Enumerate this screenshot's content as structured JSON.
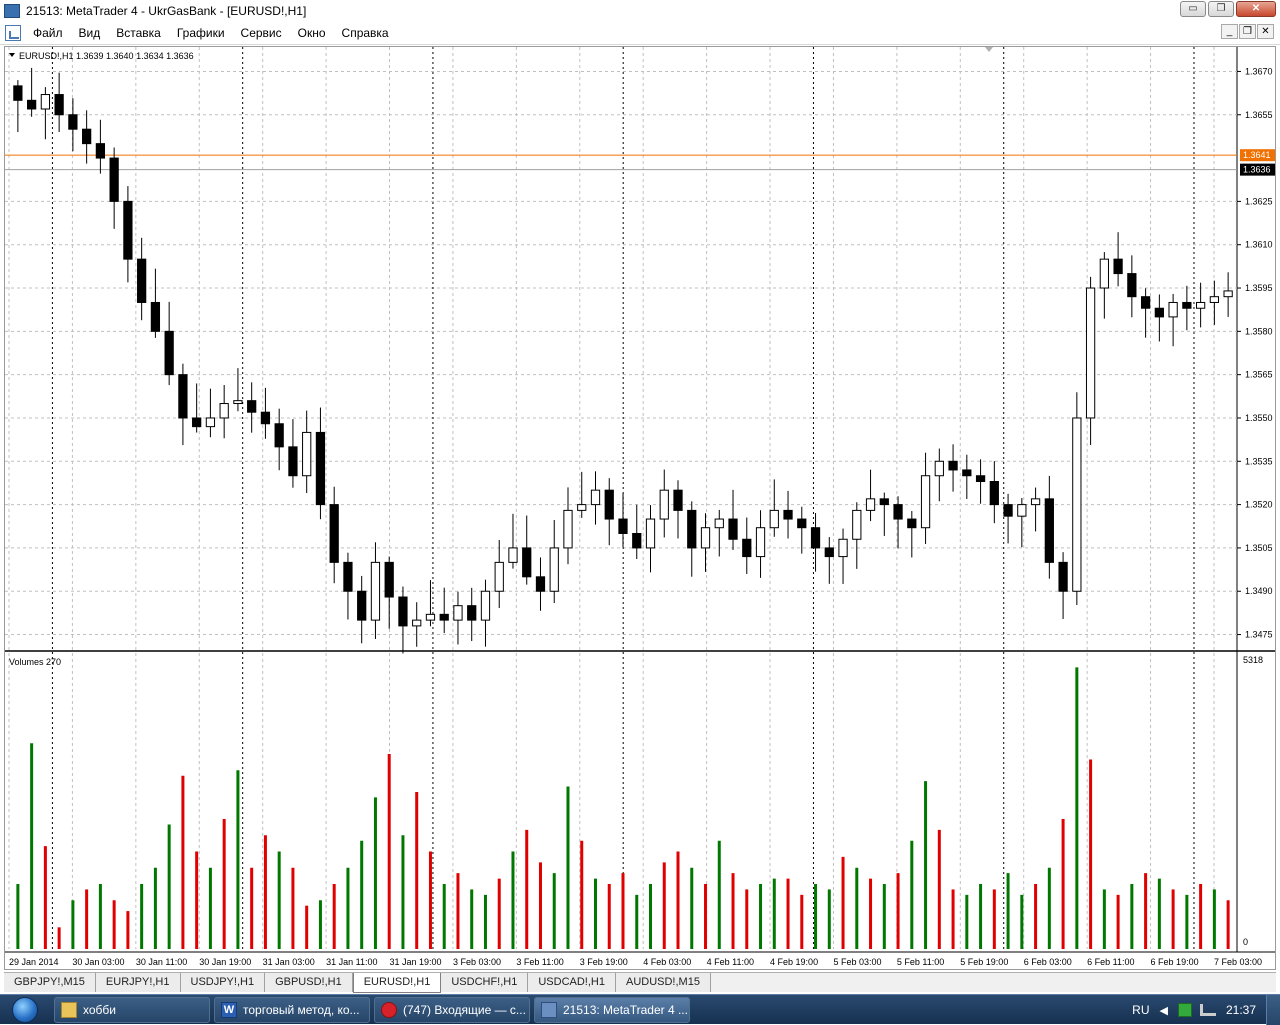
{
  "window": {
    "title": "21513: MetaTrader 4 - UkrGasBank - [EURUSD!,H1]",
    "controls": [
      "▭",
      "❐",
      "✕"
    ]
  },
  "menu": {
    "items": [
      "Файл",
      "Вид",
      "Вставка",
      "Графики",
      "Сервис",
      "Окно",
      "Справка"
    ],
    "mdi_controls": [
      "_",
      "❐",
      "✕"
    ]
  },
  "chart_header": {
    "symbol_line": "EURUSD!,H1  1.3639 1.3640 1.3634 1.3636",
    "indicator_label": "Volumes 270"
  },
  "colors": {
    "bull_volume": "#007800",
    "bear_volume": "#e00000",
    "grid": "#c0c0c0",
    "price_line": "#f07000",
    "current_price_bg": "#000000",
    "candle": "#000000"
  },
  "chart_data": [
    {
      "type": "candlestick",
      "symbol": "EURUSD!",
      "timeframe": "H1",
      "ohlc_last": {
        "open": 1.3639,
        "high": 1.364,
        "low": 1.3634,
        "close": 1.3636
      },
      "price_axis_ticks": [
        "1.3670",
        "1.3655",
        "1.3641",
        "1.3636",
        "1.3625",
        "1.3610",
        "1.3595",
        "1.3580",
        "1.3565",
        "1.3550",
        "1.3535",
        "1.3520",
        "1.3505",
        "1.3490",
        "1.3475"
      ],
      "ylim": [
        1.347,
        1.3675
      ],
      "horizontal_lines": [
        {
          "price": 1.3641,
          "label": "1.3641"
        },
        {
          "price": 1.3636,
          "label": "1.3636"
        }
      ],
      "time_axis_ticks": [
        "29 Jan 2014",
        "30 Jan 03:00",
        "30 Jan 11:00",
        "30 Jan 19:00",
        "31 Jan 03:00",
        "31 Jan 11:00",
        "31 Jan 19:00",
        "3 Feb 03:00",
        "3 Feb 11:00",
        "3 Feb 19:00",
        "4 Feb 03:00",
        "4 Feb 11:00",
        "4 Feb 19:00",
        "5 Feb 03:00",
        "5 Feb 11:00",
        "5 Feb 19:00",
        "6 Feb 03:00",
        "6 Feb 11:00",
        "6 Feb 19:00",
        "7 Feb 03:00"
      ],
      "close_path": [
        1.366,
        1.3657,
        1.3662,
        1.3655,
        1.365,
        1.3645,
        1.364,
        1.3625,
        1.3605,
        1.359,
        1.358,
        1.3565,
        1.355,
        1.3547,
        1.355,
        1.3555,
        1.3556,
        1.3552,
        1.3548,
        1.354,
        1.353,
        1.3545,
        1.352,
        1.35,
        1.349,
        1.348,
        1.35,
        1.3488,
        1.3478,
        1.348,
        1.3482,
        1.348,
        1.3485,
        1.348,
        1.349,
        1.35,
        1.3505,
        1.3495,
        1.349,
        1.3505,
        1.3518,
        1.352,
        1.3525,
        1.3515,
        1.351,
        1.3505,
        1.3515,
        1.3525,
        1.3518,
        1.3505,
        1.3512,
        1.3515,
        1.3508,
        1.3502,
        1.3512,
        1.3518,
        1.3515,
        1.3512,
        1.3505,
        1.3502,
        1.3508,
        1.3518,
        1.3522,
        1.352,
        1.3515,
        1.3512,
        1.353,
        1.3535,
        1.3532,
        1.353,
        1.3528,
        1.352,
        1.3516,
        1.352,
        1.3522,
        1.35,
        1.349,
        1.355,
        1.3595,
        1.3605,
        1.36,
        1.3592,
        1.3588,
        1.3585,
        1.359,
        1.3588,
        1.359,
        1.3592,
        1.3594
      ],
      "volume": {
        "label": "Volumes 270",
        "axis_ticks": [
          "5318",
          "0"
        ],
        "ylim": [
          0,
          5318
        ],
        "values": [
          1200,
          3800,
          1900,
          400,
          900,
          1100,
          1200,
          900,
          700,
          1200,
          1500,
          2300,
          3200,
          1800,
          1500,
          2400,
          3300,
          1500,
          2100,
          1800,
          1500,
          800,
          900,
          1200,
          1500,
          2000,
          2800,
          3600,
          2100,
          2900,
          1800,
          1200,
          1400,
          1100,
          1000,
          1300,
          1800,
          2200,
          1600,
          1400,
          3000,
          2000,
          1300,
          1200,
          1400,
          1000,
          1200,
          1600,
          1800,
          1500,
          1200,
          2000,
          1400,
          1100,
          1200,
          1300,
          1300,
          1000,
          1200,
          1100,
          1700,
          1500,
          1300,
          1200,
          1400,
          2000,
          3100,
          2200,
          1100,
          1000,
          1200,
          1100,
          1400,
          1000,
          1200,
          1500,
          2400,
          5200,
          3500,
          1100,
          1000,
          1200,
          1400,
          1300,
          1100,
          1000,
          1200,
          1100,
          900
        ],
        "direction": [
          "up",
          "up",
          "down",
          "down",
          "up",
          "down",
          "up",
          "down",
          "down",
          "up",
          "up",
          "up",
          "down",
          "down",
          "up",
          "down",
          "up",
          "down",
          "down",
          "up",
          "down",
          "down",
          "up",
          "down",
          "up",
          "up",
          "up",
          "down",
          "up",
          "down",
          "down",
          "up",
          "down",
          "up",
          "up",
          "down",
          "up",
          "down",
          "down",
          "up",
          "up",
          "down",
          "up",
          "down",
          "down",
          "up",
          "up",
          "down",
          "down",
          "up",
          "down",
          "up",
          "down",
          "down",
          "up",
          "up",
          "down",
          "down",
          "up",
          "up",
          "down",
          "up",
          "down",
          "up",
          "down",
          "up",
          "up",
          "down",
          "down",
          "up",
          "up",
          "down",
          "up",
          "up",
          "down",
          "up",
          "down",
          "up",
          "down",
          "up",
          "down",
          "up",
          "down",
          "up",
          "down",
          "up",
          "down",
          "up",
          "down"
        ]
      }
    }
  ],
  "tabs": [
    "GBPJPY!,M15",
    "EURJPY!,H1",
    "USDJPY!,H1",
    "GBPUSD!,H1",
    "EURUSD!,H1",
    "USDCHF!,H1",
    "USDCAD!,H1",
    "AUDUSD!,M15"
  ],
  "active_tab": "EURUSD!,H1",
  "taskbar": {
    "items": [
      {
        "label": "хобби",
        "icon": "folder-icon"
      },
      {
        "label": "торговый метод, ко...",
        "icon": "word-icon"
      },
      {
        "label": "(747) Входящие — с...",
        "icon": "opera-icon"
      },
      {
        "label": "21513: MetaTrader 4 ...",
        "icon": "metatrader-icon"
      }
    ],
    "tray": {
      "language": "RU",
      "time": "21:37"
    }
  }
}
